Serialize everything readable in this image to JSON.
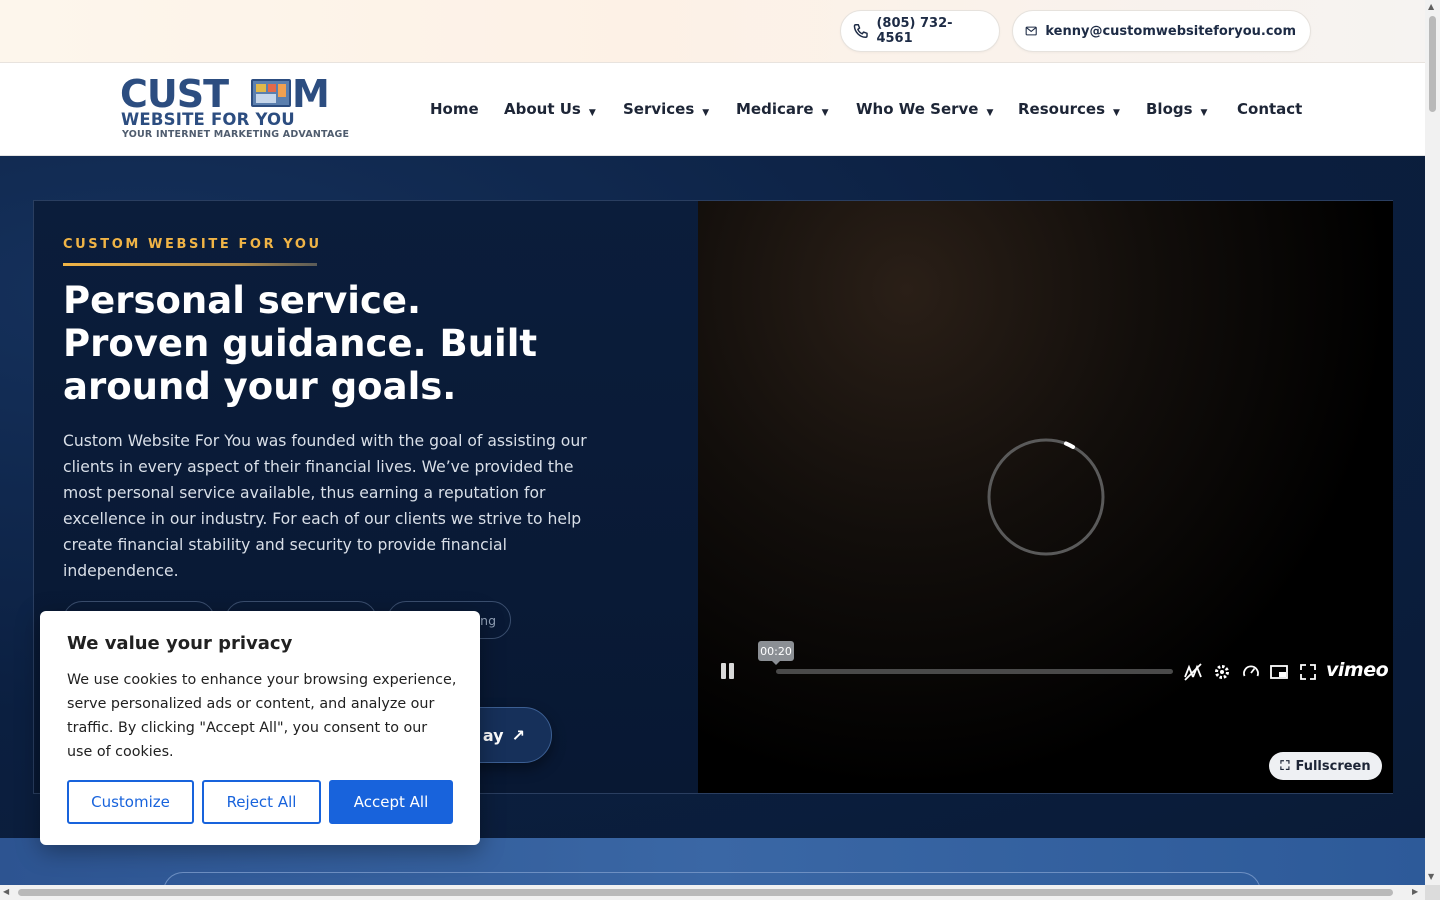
{
  "topbar": {
    "phone": "(805) 732-4561",
    "email": "kenny@customwebsiteforyou.com"
  },
  "logo": {
    "line1a": "CUST",
    "line1b": "M",
    "line2": "WEBSITE FOR YOU",
    "tagline": "YOUR INTERNET MARKETING ADVANTAGE"
  },
  "nav": {
    "items": [
      {
        "label": "Home",
        "dropdown": false
      },
      {
        "label": "About Us",
        "dropdown": true
      },
      {
        "label": "Services",
        "dropdown": true
      },
      {
        "label": "Medicare",
        "dropdown": true
      },
      {
        "label": "Who We Serve",
        "dropdown": true
      },
      {
        "label": "Resources",
        "dropdown": true
      },
      {
        "label": "Blogs",
        "dropdown": true
      },
      {
        "label": "Contact",
        "dropdown": false
      }
    ],
    "chevron": "⌄"
  },
  "hero": {
    "kicker": "CUSTOM WEBSITE FOR YOU",
    "headline": [
      "Personal service.",
      "Proven guidance. Built",
      "around your goals."
    ],
    "paragraph": "Custom Website For You was founded with the goal of assisting our clients in every aspect of their financial lives. We’ve provided the most personal service available, thus earning a reputation for excellence in our industry. For each of our clients we strive to help create financial stability and security to provide financial independence.",
    "chips": [
      "",
      "",
      "ng"
    ],
    "cta_label": "ay",
    "cta_icon": "↗"
  },
  "video": {
    "time_tooltip": "00:20",
    "brand": "vimeo",
    "fullscreen_label": "Fullscreen",
    "fullscreen_icon": "⛶"
  },
  "cookie": {
    "title": "We value your privacy",
    "body": "We use cookies to enhance your browsing experience, serve personalized ads or content, and analyze our traffic. By clicking \"Accept All\", you consent to our use of cookies.",
    "customize": "Customize",
    "reject": "Reject All",
    "accept": "Accept All"
  },
  "colors": {
    "accent_gold": "#f0b446",
    "navy": "#0b1f40",
    "cookie_blue": "#1863dc",
    "brand_blue": "#2c4d80"
  }
}
